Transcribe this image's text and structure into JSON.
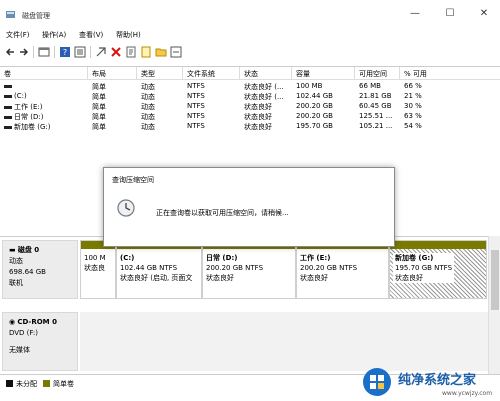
{
  "window": {
    "title": "磁盘管理",
    "minimize": "—",
    "maximize": "☐",
    "close": "✕"
  },
  "menu": [
    "文件(F)",
    "操作(A)",
    "查看(V)",
    "帮助(H)"
  ],
  "toolbar_icons": [
    "back-icon",
    "forward-icon",
    "console-icon",
    "help-icon",
    "list-icon",
    "connect-icon",
    "delete-icon",
    "properties-icon",
    "new-icon",
    "folder-icon",
    "settings-icon"
  ],
  "table": {
    "headers": [
      "卷",
      "布局",
      "类型",
      "文件系统",
      "状态",
      "容量",
      "可用空间",
      "% 可用"
    ],
    "rows": [
      [
        "",
        "简单",
        "动态",
        "NTFS",
        "状态良好 (...",
        "100 MB",
        "66 MB",
        "66 %"
      ],
      [
        "(C:)",
        "简单",
        "动态",
        "NTFS",
        "状态良好 (...",
        "102.44 GB",
        "21.81 GB",
        "21 %"
      ],
      [
        "工作 (E:)",
        "简单",
        "动态",
        "NTFS",
        "状态良好",
        "200.20 GB",
        "60.45 GB",
        "30 %"
      ],
      [
        "日常 (D:)",
        "简单",
        "动态",
        "NTFS",
        "状态良好",
        "200.20 GB",
        "125.51 ...",
        "63 %"
      ],
      [
        "新加卷 (G:)",
        "简单",
        "动态",
        "NTFS",
        "状态良好",
        "195.70 GB",
        "105.21 ...",
        "54 %"
      ]
    ]
  },
  "dialog": {
    "title": "查询压缩空间",
    "message": "正在查询卷以获取可用压缩空间，请稍候..."
  },
  "disk0": {
    "name": "磁盘 0",
    "type": "动态",
    "size": "698.64 GB",
    "status": "联机",
    "partitions": [
      {
        "name": "",
        "size": "100 M",
        "status": "状态良"
      },
      {
        "name": "(C:)",
        "size": "102.44 GB NTFS",
        "status": "状态良好 (启动, 页面文"
      },
      {
        "name": "日常 (D:)",
        "size": "200.20 GB NTFS",
        "status": "状态良好"
      },
      {
        "name": "工作 (E:)",
        "size": "200.20 GB NTFS",
        "status": "状态良好"
      },
      {
        "name": "新加卷 (G:)",
        "size": "195.70 GB NTFS",
        "status": "状态良好"
      }
    ]
  },
  "cdrom0": {
    "name": "CD-ROM 0",
    "type": "DVD (F:)",
    "status": "无媒体"
  },
  "legend": [
    {
      "label": "未分配",
      "color": "#111111"
    },
    {
      "label": "简单卷",
      "color": "#7a7a00"
    }
  ],
  "watermark": {
    "name": "纯净系统之家",
    "url": "www.ycwjzy.com"
  }
}
